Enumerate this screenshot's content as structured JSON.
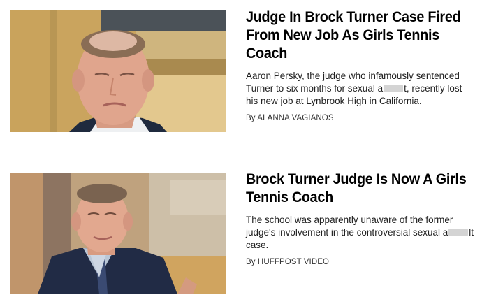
{
  "articles": [
    {
      "headline": "Judge In Brock Turner Case Fired From New Job As Girls Tennis Coach",
      "blurb_before": "Aaron Persky, the judge who infamously sentenced Turner to six months for sexual a",
      "blurb_after": "t, recently lost his new job at Lynbrook High in California.",
      "byline_prefix": "By",
      "author": "ALANNA VAGIANOS"
    },
    {
      "headline": "Brock Turner Judge Is Now A Girls Tennis Coach",
      "blurb_before": "The school was apparently unaware of the former judge's involvement in the controversial sexual a",
      "blurb_after": "lt case.",
      "byline_prefix": "By",
      "author": "HUFFPOST VIDEO"
    }
  ],
  "colors": {
    "text": "#000000",
    "muted": "#333333",
    "divider": "#dedede",
    "redaction": "#d4d4d4"
  }
}
